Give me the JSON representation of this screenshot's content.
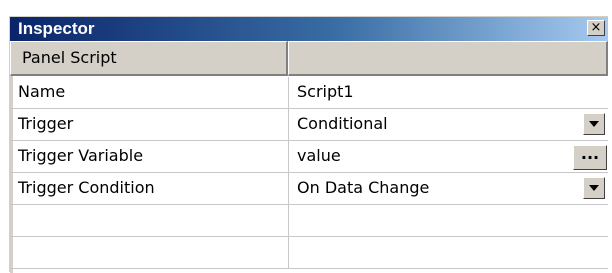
{
  "window": {
    "title": "Inspector",
    "close_glyph": "×"
  },
  "header": {
    "name_column": "Panel Script",
    "value_column": ""
  },
  "properties": [
    {
      "name": "Name",
      "value": "Script1",
      "control": "none"
    },
    {
      "name": "Trigger",
      "value": "Conditional",
      "control": "dropdown"
    },
    {
      "name": "Trigger Variable",
      "value": "value",
      "control": "ellipsis"
    },
    {
      "name": "Trigger Condition",
      "value": "On Data Change",
      "control": "dropdown"
    }
  ],
  "ellipsis_label": "...",
  "colors": {
    "titlebar_start": "#0a246a",
    "titlebar_end": "#a6caf0",
    "button_face": "#d4d0c8"
  }
}
